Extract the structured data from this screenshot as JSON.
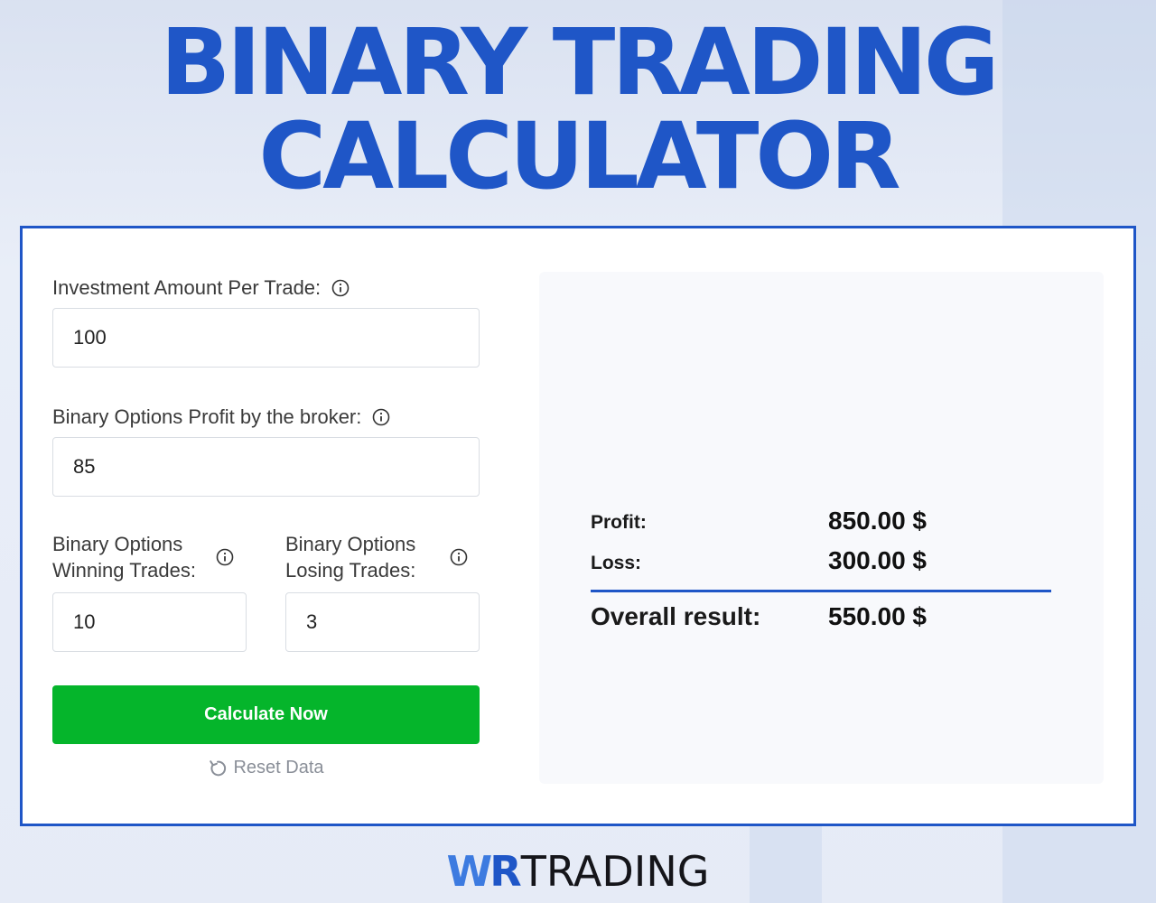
{
  "header": {
    "title_line1": "BINARY TRADING",
    "title_line2": "CALCULATOR"
  },
  "form": {
    "investment": {
      "label": "Investment Amount Per Trade:",
      "value": "100",
      "icon": "info-icon"
    },
    "profit_percent": {
      "label": "Binary Options Profit by the broker:",
      "value": "85",
      "icon": "info-icon"
    },
    "winning_trades": {
      "label_line1": "Binary Options",
      "label_line2": "Winning Trades:",
      "value": "10",
      "icon": "info-icon"
    },
    "losing_trades": {
      "label_line1": "Binary Options",
      "label_line2": "Losing Trades:",
      "value": "3",
      "icon": "info-icon"
    },
    "calculate_label": "Calculate Now",
    "reset_label": "Reset Data",
    "reset_icon": "refresh-icon"
  },
  "results": {
    "profit_label": "Profit:",
    "profit_value": "850.00 $",
    "loss_label": "Loss:",
    "loss_value": "300.00 $",
    "overall_label": "Overall result:",
    "overall_value": "550.00 $"
  },
  "footer": {
    "logo_w": "W",
    "logo_r": "R",
    "logo_text": "TRADING"
  },
  "colors": {
    "brand_blue": "#1f56c7",
    "button_green": "#05b52b",
    "background": "#e9eef8"
  }
}
